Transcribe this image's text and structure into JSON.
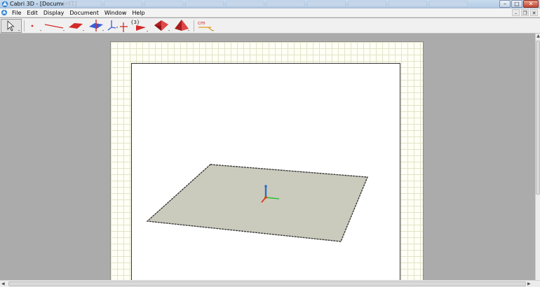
{
  "window": {
    "title": "Cabri 3D - [Document1]",
    "app_icon": "cabri-logo-icon",
    "controls": {
      "minimize": "–",
      "maximize": "□",
      "close": "✕"
    }
  },
  "menubar": {
    "items": [
      {
        "label": "File"
      },
      {
        "label": "Edit"
      },
      {
        "label": "Display"
      },
      {
        "label": "Document"
      },
      {
        "label": "Window"
      },
      {
        "label": "Help"
      }
    ],
    "doc_controls": {
      "minimize": "–",
      "restore": "❐",
      "close": "✕"
    }
  },
  "toolbar": {
    "tools": [
      {
        "name": "manipulation-tool",
        "icon": "cursor-arrow-icon"
      },
      {
        "name": "point-tool",
        "icon": "point-icon"
      },
      {
        "name": "line-tool",
        "icon": "line-icon"
      },
      {
        "name": "surface-tool",
        "icon": "plane-icon"
      },
      {
        "name": "relative-construction-tool",
        "icon": "perpendicular-plane-icon"
      },
      {
        "name": "transformation-tool",
        "icon": "axes-icon"
      },
      {
        "name": "set-tool",
        "icon": "set-icon",
        "label": "{3}"
      },
      {
        "name": "polygon-tool",
        "icon": "triangle-icon"
      },
      {
        "name": "polyhedron-tool",
        "icon": "polyhedron-icon"
      },
      {
        "name": "regular-polyhedron-tool",
        "icon": "pyramid-icon"
      },
      {
        "name": "measurement-tool",
        "icon": "measure-icon",
        "label": "cm"
      }
    ]
  },
  "colors": {
    "tool_red": "#d42a2a",
    "tool_blue": "#3b5bd6",
    "base_plane": "#cbcbbd",
    "axis_z": "#2d6fc2",
    "axis_y": "#2ec23a",
    "axis_x": "#d83a1e",
    "grid_page": "#fffff6"
  },
  "scrollbars": {
    "up": "▲",
    "left": "◀",
    "right": "▶"
  }
}
